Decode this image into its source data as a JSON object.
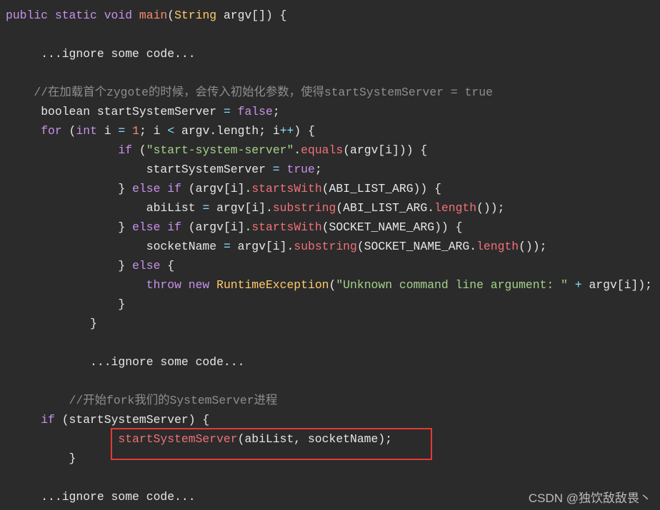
{
  "colors": {
    "background": "#2b2b2b",
    "highlight_box": "#e53935",
    "keyword": "#c792ea",
    "string": "#a5d18c",
    "comment": "#8e8e8e"
  },
  "code_lines": [
    {
      "indent": 0,
      "tokens": [
        [
          "kw",
          "public static void "
        ],
        [
          "fn",
          "main"
        ],
        [
          "id",
          "("
        ],
        [
          "ty",
          "String"
        ],
        [
          "id",
          " argv[]) {"
        ]
      ]
    },
    {
      "indent": 0,
      "tokens": []
    },
    {
      "indent": 5,
      "tokens": [
        [
          "id",
          "...ignore some code..."
        ]
      ]
    },
    {
      "indent": 0,
      "tokens": []
    },
    {
      "indent": 4,
      "tokens": [
        [
          "cm",
          "//在加载首个zygote的时候，会传入初始化参数，使得startSystemServer = true"
        ]
      ]
    },
    {
      "indent": 5,
      "tokens": [
        [
          "id",
          "boolean startSystemServer "
        ],
        [
          "op",
          "="
        ],
        [
          "id",
          " "
        ],
        [
          "kw",
          "false"
        ],
        [
          "id",
          ";"
        ]
      ]
    },
    {
      "indent": 5,
      "tokens": [
        [
          "kw",
          "for"
        ],
        [
          "id",
          " ("
        ],
        [
          "kw",
          "int"
        ],
        [
          "id",
          " i "
        ],
        [
          "op",
          "="
        ],
        [
          "id",
          " "
        ],
        [
          "num",
          "1"
        ],
        [
          "id",
          "; i "
        ],
        [
          "op",
          "<"
        ],
        [
          "id",
          " argv.length; i"
        ],
        [
          "op",
          "++"
        ],
        [
          "id",
          ") {"
        ]
      ]
    },
    {
      "indent": 16,
      "tokens": [
        [
          "kw",
          "if"
        ],
        [
          "id",
          " ("
        ],
        [
          "str",
          "\"start-system-server\""
        ],
        [
          "id",
          "."
        ],
        [
          "mth",
          "equals"
        ],
        [
          "id",
          "(argv[i])) {"
        ]
      ]
    },
    {
      "indent": 20,
      "tokens": [
        [
          "id",
          "startSystemServer "
        ],
        [
          "op",
          "="
        ],
        [
          "id",
          " "
        ],
        [
          "kw",
          "true"
        ],
        [
          "id",
          ";"
        ]
      ]
    },
    {
      "indent": 16,
      "tokens": [
        [
          "id",
          "} "
        ],
        [
          "kw",
          "else if"
        ],
        [
          "id",
          " (argv[i]."
        ],
        [
          "mth",
          "startsWith"
        ],
        [
          "id",
          "(ABI_LIST_ARG)) {"
        ]
      ]
    },
    {
      "indent": 20,
      "tokens": [
        [
          "id",
          "abiList "
        ],
        [
          "op",
          "="
        ],
        [
          "id",
          " argv[i]."
        ],
        [
          "mth",
          "substring"
        ],
        [
          "id",
          "(ABI_LIST_ARG."
        ],
        [
          "mth",
          "length"
        ],
        [
          "id",
          "());"
        ]
      ]
    },
    {
      "indent": 16,
      "tokens": [
        [
          "id",
          "} "
        ],
        [
          "kw",
          "else if"
        ],
        [
          "id",
          " (argv[i]."
        ],
        [
          "mth",
          "startsWith"
        ],
        [
          "id",
          "(SOCKET_NAME_ARG)) {"
        ]
      ]
    },
    {
      "indent": 20,
      "tokens": [
        [
          "id",
          "socketName "
        ],
        [
          "op",
          "="
        ],
        [
          "id",
          " argv[i]."
        ],
        [
          "mth",
          "substring"
        ],
        [
          "id",
          "(SOCKET_NAME_ARG."
        ],
        [
          "mth",
          "length"
        ],
        [
          "id",
          "());"
        ]
      ]
    },
    {
      "indent": 16,
      "tokens": [
        [
          "id",
          "} "
        ],
        [
          "kw",
          "else"
        ],
        [
          "id",
          " {"
        ]
      ]
    },
    {
      "indent": 20,
      "tokens": [
        [
          "kw",
          "throw new "
        ],
        [
          "cls",
          "RuntimeException"
        ],
        [
          "id",
          "("
        ],
        [
          "str",
          "\"Unknown command line argument: \""
        ],
        [
          "id",
          " "
        ],
        [
          "op",
          "+"
        ],
        [
          "id",
          " argv[i]);"
        ]
      ]
    },
    {
      "indent": 16,
      "tokens": [
        [
          "id",
          "}"
        ]
      ]
    },
    {
      "indent": 12,
      "tokens": [
        [
          "id",
          "}"
        ]
      ]
    },
    {
      "indent": 0,
      "tokens": []
    },
    {
      "indent": 12,
      "tokens": [
        [
          "id",
          "...ignore some code..."
        ]
      ]
    },
    {
      "indent": 0,
      "tokens": []
    },
    {
      "indent": 9,
      "tokens": [
        [
          "cm",
          "//开始fork我们的SystemServer进程"
        ]
      ]
    },
    {
      "indent": 5,
      "tokens": [
        [
          "kw",
          "if"
        ],
        [
          "id",
          " (startSystemServer) {"
        ]
      ]
    },
    {
      "indent": 16,
      "tokens": [
        [
          "mth",
          "startSystemServer"
        ],
        [
          "id",
          "(abiList, socketName);"
        ]
      ]
    },
    {
      "indent": 9,
      "tokens": [
        [
          "id",
          "}"
        ]
      ]
    },
    {
      "indent": 0,
      "tokens": []
    },
    {
      "indent": 5,
      "tokens": [
        [
          "id",
          "...ignore some code..."
        ]
      ]
    }
  ],
  "watermark": "CSDN @独饮敌敌畏丶"
}
